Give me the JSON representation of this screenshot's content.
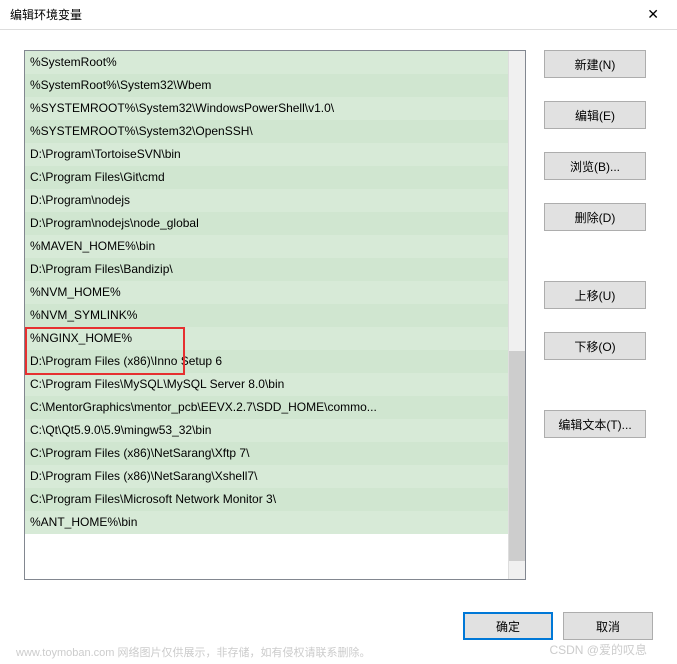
{
  "window": {
    "title": "编辑环境变量"
  },
  "list": {
    "items": [
      "%SystemRoot%",
      "%SystemRoot%\\System32\\Wbem",
      "%SYSTEMROOT%\\System32\\WindowsPowerShell\\v1.0\\",
      "%SYSTEMROOT%\\System32\\OpenSSH\\",
      "D:\\Program\\TortoiseSVN\\bin",
      "C:\\Program Files\\Git\\cmd",
      "D:\\Program\\nodejs",
      "D:\\Program\\nodejs\\node_global",
      "%MAVEN_HOME%\\bin",
      "D:\\Program Files\\Bandizip\\",
      "%NVM_HOME%",
      "%NVM_SYMLINK%",
      "%NGINX_HOME%",
      "D:\\Program Files (x86)\\Inno Setup 6",
      "C:\\Program Files\\MySQL\\MySQL Server 8.0\\bin",
      "C:\\MentorGraphics\\mentor_pcb\\EEVX.2.7\\SDD_HOME\\commo...",
      "C:\\Qt\\Qt5.9.0\\5.9\\mingw53_32\\bin",
      "C:\\Program Files (x86)\\NetSarang\\Xftp 7\\",
      "D:\\Program Files (x86)\\NetSarang\\Xshell7\\",
      "C:\\Program Files\\Microsoft Network Monitor 3\\",
      "%ANT_HOME%\\bin"
    ]
  },
  "buttons": {
    "new": "新建(N)",
    "edit": "编辑(E)",
    "browse": "浏览(B)...",
    "delete": "删除(D)",
    "up": "上移(U)",
    "down": "下移(O)",
    "editText": "编辑文本(T)...",
    "ok": "确定",
    "cancel": "取消"
  },
  "watermark": {
    "left": "www.toymoban.com 网络图片仅供展示，非存储，如有侵权请联系删除。",
    "right": "CSDN @爱的叹息"
  }
}
